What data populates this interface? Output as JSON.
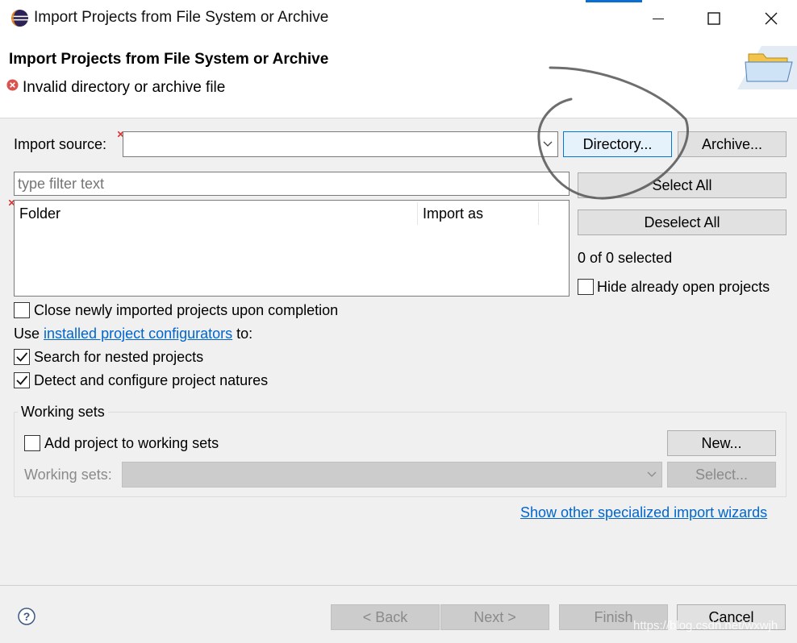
{
  "window": {
    "title": "Import Projects from File System or Archive"
  },
  "header": {
    "title": "Import Projects from File System or Archive",
    "error_message": "Invalid directory or archive file"
  },
  "import_source": {
    "label": "Import source:",
    "value": "",
    "directory_button": "Directory...",
    "archive_button": "Archive..."
  },
  "filter": {
    "placeholder": "type filter text"
  },
  "table": {
    "columns": [
      "Folder",
      "Import as"
    ],
    "rows": []
  },
  "selection": {
    "select_all": "Select All",
    "deselect_all": "Deselect All",
    "count_text": "0 of 0 selected",
    "hide_open_label": "Hide already open projects",
    "hide_open_checked": false
  },
  "options": {
    "close_label": "Close newly imported projects upon completion",
    "close_checked": false,
    "use_prefix": "Use",
    "configurators_link": "installed project configurators",
    "use_suffix": "to:",
    "nested_label": "Search for nested projects",
    "nested_checked": true,
    "natures_label": "Detect and configure project natures",
    "natures_checked": true
  },
  "working_sets": {
    "group_title": "Working sets",
    "add_label": "Add project to working sets",
    "add_checked": false,
    "new_button": "New...",
    "sets_label": "Working sets:",
    "sets_value": "",
    "select_button": "Select..."
  },
  "specialized_link": "Show other specialized import wizards",
  "footer": {
    "help_icon": "question-mark",
    "back": "< Back",
    "next": "Next >",
    "finish": "Finish",
    "cancel": "Cancel",
    "watermark": "https://blog.csdn.net/wxwjh"
  },
  "colors": {
    "accent": "#0078d7",
    "link": "#0066cc",
    "error": "#d9534f"
  }
}
